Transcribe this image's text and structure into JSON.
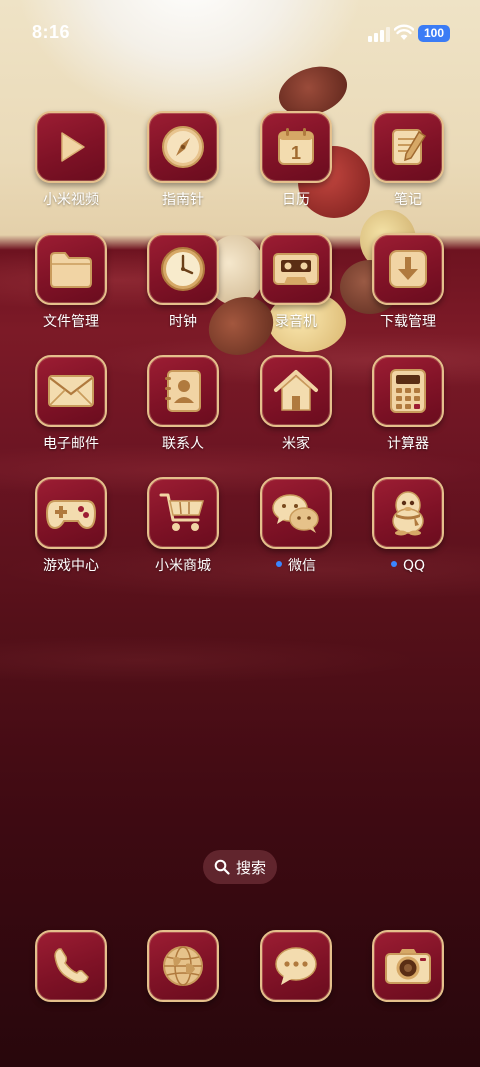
{
  "status_bar": {
    "time": "8:16",
    "battery_level": "100",
    "battery_color": "#3b7cf5",
    "icons": [
      "signal-icon",
      "wifi-icon",
      "battery-icon"
    ]
  },
  "apps": [
    {
      "label": "小米视频",
      "icon": "video-play-icon"
    },
    {
      "label": "指南针",
      "icon": "compass-icon"
    },
    {
      "label": "日历",
      "icon": "calendar-icon",
      "calendar_day": "1"
    },
    {
      "label": "笔记",
      "icon": "notes-icon"
    },
    {
      "label": "文件管理",
      "icon": "folder-icon"
    },
    {
      "label": "时钟",
      "icon": "clock-icon"
    },
    {
      "label": "录音机",
      "icon": "cassette-icon"
    },
    {
      "label": "下载管理",
      "icon": "download-icon"
    },
    {
      "label": "电子邮件",
      "icon": "mail-icon"
    },
    {
      "label": "联系人",
      "icon": "contacts-icon"
    },
    {
      "label": "米家",
      "icon": "home-icon"
    },
    {
      "label": "计算器",
      "icon": "calculator-icon"
    },
    {
      "label": "游戏中心",
      "icon": "gamepad-icon"
    },
    {
      "label": "小米商城",
      "icon": "shopping-cart-icon"
    },
    {
      "label": "微信",
      "icon": "wechat-icon",
      "notification_dot": true
    },
    {
      "label": "QQ",
      "icon": "qq-penguin-icon",
      "notification_dot": true
    }
  ],
  "search": {
    "label": "搜索",
    "icon": "search-icon"
  },
  "dock": [
    {
      "icon": "phone-icon"
    },
    {
      "icon": "browser-globe-icon"
    },
    {
      "icon": "messages-icon"
    },
    {
      "icon": "camera-icon"
    }
  ],
  "colors": {
    "icon_background": "#8a1529",
    "icon_border": "#e5c08c",
    "icon_glyph": "#f1d4a4",
    "notification_dot": "#3a86ff"
  }
}
